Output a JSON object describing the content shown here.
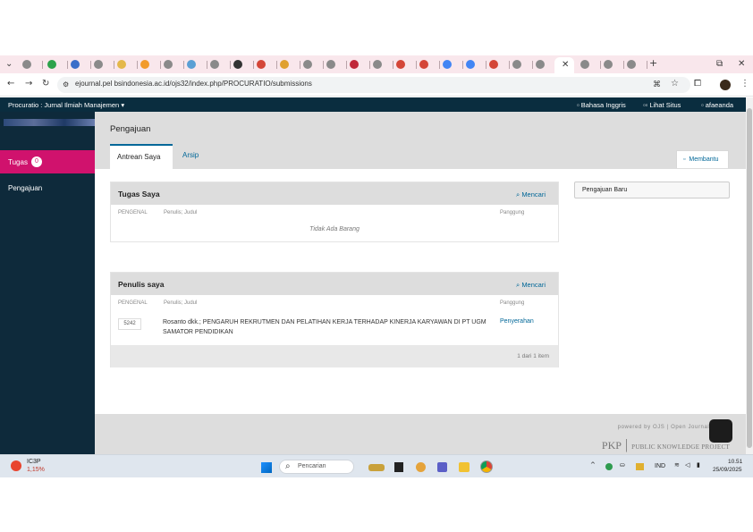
{
  "browser": {
    "url": "ejournal.pel bsindonesia.ac.id/ojs32/index.php/PROCURATIO/submissions"
  },
  "ojs_header": {
    "journal_name": "Procuratio : Jurnal Ilmiah Manajemen",
    "language": "Bahasa Inggris",
    "view_site": "Lihat Situs",
    "username": "afaeanda"
  },
  "sidebar": {
    "tasks_label": "Tugas",
    "tasks_count": "0",
    "submissions_label": "Pengajuan"
  },
  "page": {
    "title": "Pengajuan",
    "tabs": [
      "Antrean Saya",
      "Arsip"
    ],
    "help_label": "Membantu",
    "new_submission": "Pengajuan Baru"
  },
  "my_tasks": {
    "title": "Tugas Saya",
    "search": "Mencari",
    "col_id": "PENGENAL",
    "col_author": "Penulis; Judul",
    "col_stage": "Panggung",
    "empty": "Tidak Ada Barang"
  },
  "my_authored": {
    "title": "Penulis saya",
    "search": "Mencari",
    "col_id": "PENGENAL",
    "col_author": "Penulis; Judul",
    "col_stage": "Panggung",
    "rows": [
      {
        "id": "5242",
        "title": "Rosanto dkk.; PENGARUH REKRUTMEN DAN PELATIHAN KERJA TERHADAP KINERJA KARYAWAN DI PT UGM SAMATOR PENDIDIKAN",
        "stage": "Penyerahan"
      }
    ],
    "pagination": "1 dari 1 item"
  },
  "footer": {
    "powered_by": "powered by OJS | Open Journal S...",
    "pkp_abbr": "PKP",
    "pkp_full": "PUBLIC KNOWLEDGE PROJECT"
  },
  "taskbar": {
    "weather_temp": "IC3P",
    "weather_change": "1,15%",
    "search_placeholder": "Pencarian",
    "language": "IND",
    "time": "10.51",
    "date": "25/09/2025"
  }
}
